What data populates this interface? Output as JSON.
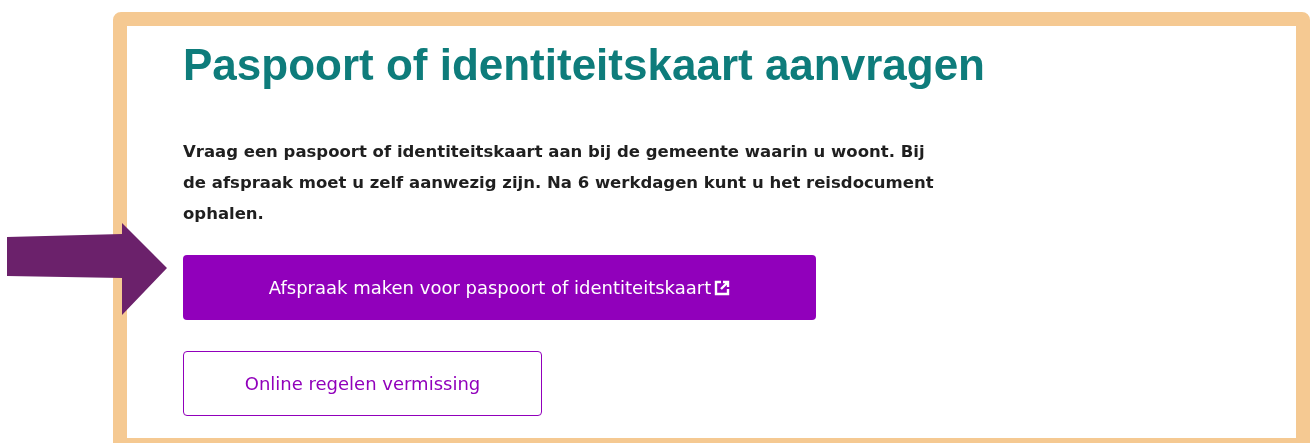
{
  "title": "Paspoort of identiteitskaart aanvragen",
  "intro": "Vraag een paspoort of identiteitskaart aan bij de gemeente waarin u woont. Bij de afspraak moet u zelf aanwezig zijn. Na 6 werkdagen kunt u het reisdocument ophalen.",
  "buttons": [
    {
      "label": "Afspraak maken voor paspoort of identiteitskaart",
      "kind": "primary",
      "external": true
    },
    {
      "label": "Online regelen vermissing",
      "kind": "secondary",
      "external": false
    }
  ]
}
